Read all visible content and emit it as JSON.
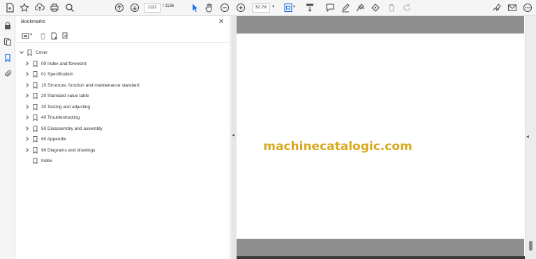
{
  "toolbar": {
    "current_page": "1122",
    "total_pages": "/ 1136",
    "zoom": "32.1%",
    "icons": [
      "create-pdf-icon",
      "star-icon",
      "upload-icon",
      "print-icon",
      "search-icon",
      "prev-page-icon",
      "next-page-icon",
      "select-cursor-icon",
      "hand-icon",
      "zoom-out-icon",
      "zoom-in-icon",
      "fit-page-icon",
      "scroll-mode-icon",
      "comment-icon",
      "pen-icon",
      "highlight-icon",
      "stamp-icon",
      "delete-icon",
      "undo-icon",
      "sign-icon",
      "email-icon",
      "more-icon"
    ]
  },
  "bookmarks_panel": {
    "title": "Bookmarks",
    "close_glyph": "✕",
    "items": [
      {
        "label": "Cover",
        "expanded": true,
        "level": 0
      },
      {
        "label": "00 Index and foreword",
        "expanded": false,
        "level": 1
      },
      {
        "label": "01 Specification",
        "expanded": false,
        "level": 1
      },
      {
        "label": "10 Structure, function and maintenance standard",
        "expanded": false,
        "level": 1
      },
      {
        "label": "20 Standard value table",
        "expanded": false,
        "level": 1
      },
      {
        "label": "30 Testing and adjusting",
        "expanded": false,
        "level": 1
      },
      {
        "label": "40 Troubleshooting",
        "expanded": false,
        "level": 1
      },
      {
        "label": "50 Disassembly and assembly",
        "expanded": false,
        "level": 1
      },
      {
        "label": "80 Appendix",
        "expanded": false,
        "level": 1
      },
      {
        "label": "90 Diagrams and drawings",
        "expanded": false,
        "level": 1
      },
      {
        "label": "Index",
        "expanded": null,
        "level": 1
      }
    ]
  },
  "document": {
    "watermark": "machinecatalogic.com",
    "watermark_color": "#d9a81c"
  },
  "colors": {
    "accent": "#1473e6",
    "page_gray": "#8e8e8e"
  }
}
